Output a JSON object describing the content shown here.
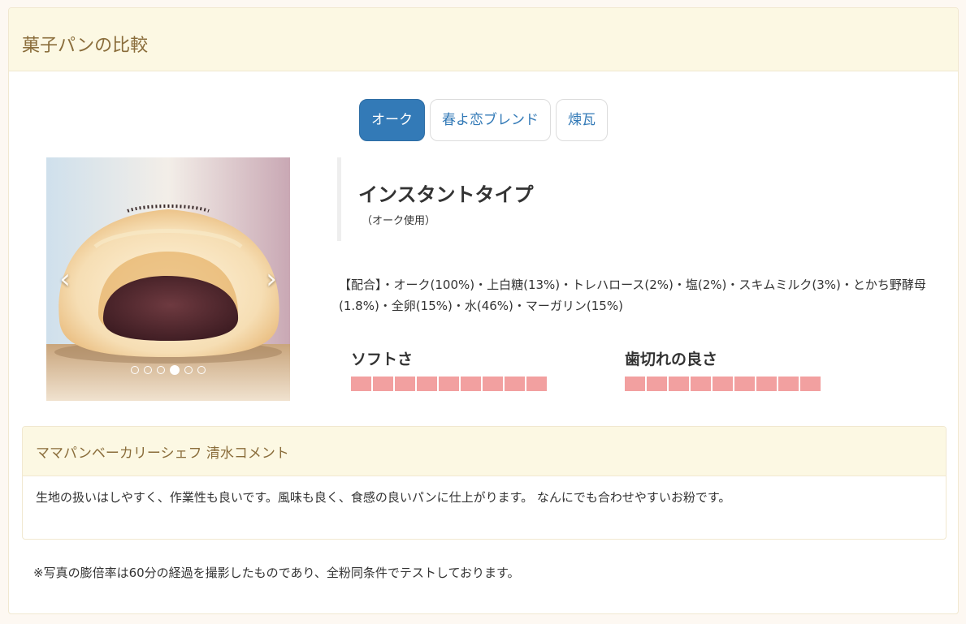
{
  "header": {
    "title": "菓子パンの比較"
  },
  "tabs": [
    {
      "label": "オーク",
      "active": true
    },
    {
      "label": "春よ恋ブレンド",
      "active": false
    },
    {
      "label": "煉瓦",
      "active": false
    }
  ],
  "carousel": {
    "prev_icon": "chevron-left-icon",
    "next_icon": "chevron-right-icon",
    "slide_count": 6,
    "active_slide": 4
  },
  "product": {
    "title": "インスタントタイプ",
    "subtitle": "（オーク使用）"
  },
  "recipe": {
    "text": "【配合】・オーク(100%)・上白糖(13%)・トレハロース(2%)・塩(2%)・スキムミルク(3%)・とかち野酵母(1.8%)・全卵(15%)・水(46%)・マーガリン(15%)"
  },
  "metrics": {
    "softness": {
      "label": "ソフトさ",
      "score": 9,
      "max": 9
    },
    "bite": {
      "label": "歯切れの良さ",
      "score": 9,
      "max": 9
    }
  },
  "comment": {
    "heading": "ママパンベーカリーシェフ 清水コメント",
    "body": "生地の扱いはしやすく、作業性も良いです。風味も良く、食感の良いパンに仕上がります。 なんにでも合わせやすいお粉です。"
  },
  "footnote": "※写真の膨倍率は60分の経過を撮影したものであり、全粉同条件でテストしております。",
  "colors": {
    "accent": "#337ab7",
    "heading_bg": "#fcf8e3",
    "heading_text": "#8a6d3b",
    "bar": "#f2a0a0"
  }
}
